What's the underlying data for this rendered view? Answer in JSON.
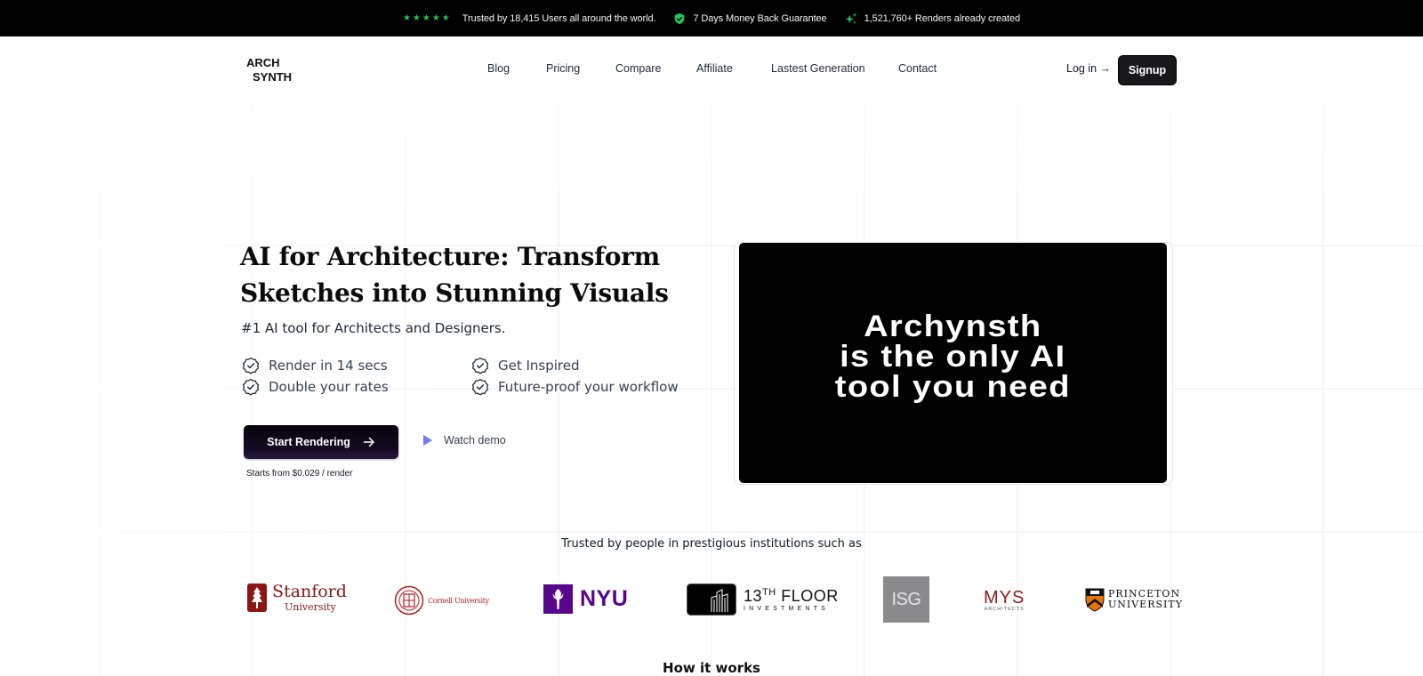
{
  "topbar": {
    "rating_stars": 5,
    "trusted_text": "Trusted by 18,415 Users all around the world.",
    "guarantee_text": "7 Days Money Back Guarantee",
    "renders_text": "1,521,760+ Renders already created",
    "colors": {
      "accent": "#22c55e",
      "background": "#000000"
    },
    "icons": [
      "star-icon",
      "shield-check-icon",
      "sparkles-icon"
    ]
  },
  "nav": {
    "logo_line1": "ARCH",
    "logo_line2": "SYNTH",
    "links": [
      {
        "label": "Blog"
      },
      {
        "label": "Pricing"
      },
      {
        "label": "Compare"
      },
      {
        "label": "Affiliate"
      },
      {
        "label": "Lastest Generation"
      },
      {
        "label": "Contact"
      }
    ],
    "login_label": "Log in →",
    "signup_label": "Signup"
  },
  "hero": {
    "title": "AI for Architecture: Transform Sketches into Stunning Visuals",
    "subtitle": "#1 AI tool for Architects and Designers.",
    "features": [
      "Render in 14 secs",
      "Double your rates",
      "Get Inspired",
      "Future-proof your workflow"
    ],
    "cta_label": "Start Rendering",
    "watch_label": "Watch demo",
    "price_note": "Starts from $0.029 / render",
    "video_text": "Archynsth\nis the only AI\ntool you need",
    "colors": {
      "play_icon": "#6b7cf6"
    }
  },
  "trusted": {
    "heading": "Trusted by people in prestigious institutions such as",
    "logos": [
      {
        "name": "Stanford",
        "line1": "Stanford",
        "line2": "University",
        "color": "#8c1515"
      },
      {
        "name": "Cornell",
        "line1": "Cornell University",
        "color": "#b31b1b"
      },
      {
        "name": "NYU",
        "line1": "NYU",
        "color": "#57068c"
      },
      {
        "name": "13th Floor",
        "line1": "13",
        "sup": "TH",
        "line1b": "FLOOR",
        "line2": "INVESTMENTS",
        "color": "#111111"
      },
      {
        "name": "ISG",
        "line1": "ISG",
        "color": "#8a8a8c"
      },
      {
        "name": "MYS",
        "line1": "MYS",
        "line2": "ARCHITECTS",
        "color": "#8b1d1d"
      },
      {
        "name": "Princeton",
        "line1": "PRINCETON",
        "line2": "UNIVERSITY",
        "color": "#e77500"
      }
    ]
  },
  "next_section": {
    "heading": "How it works"
  }
}
